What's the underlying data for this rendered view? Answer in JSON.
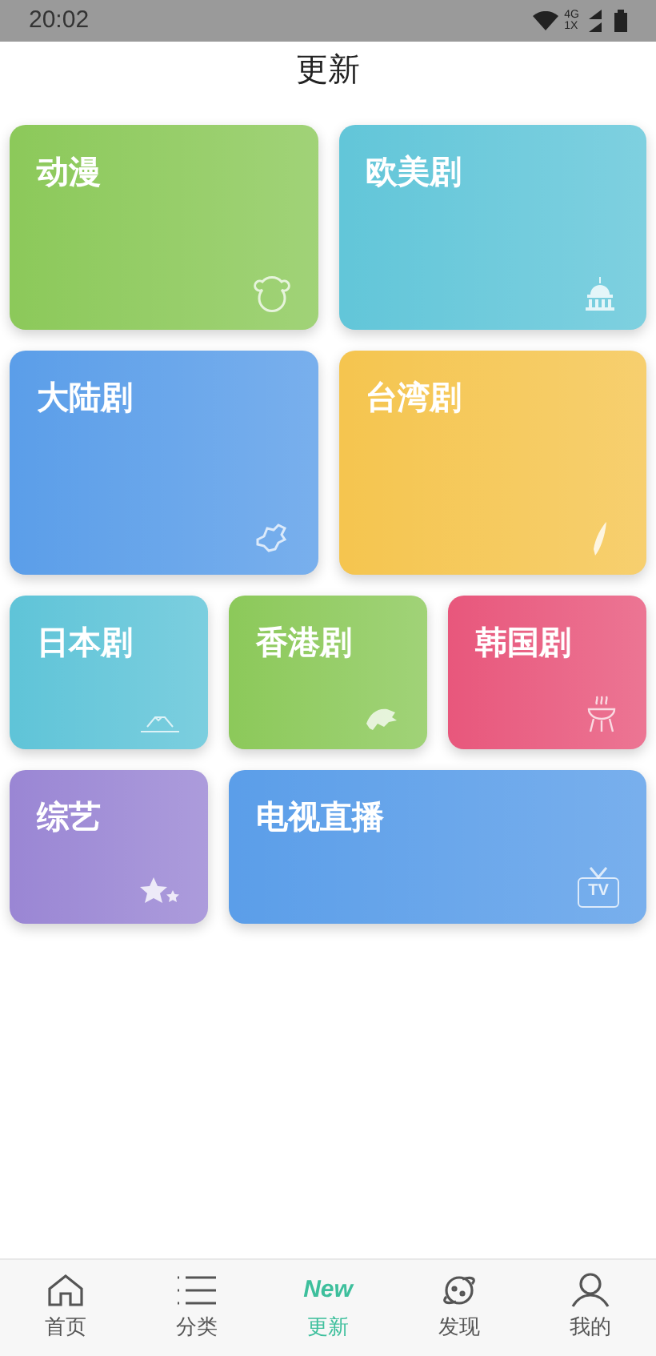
{
  "status_bar": {
    "time": "20:02",
    "network_top": "4G",
    "network_bottom": "1X"
  },
  "title": "更新",
  "card_rows": [
    {
      "cards": [
        {
          "label": "动漫",
          "color": "#8cc95a"
        },
        {
          "label": "欧美剧",
          "color": "#62c6d9"
        }
      ]
    },
    {
      "cards": [
        {
          "label": "大陆剧",
          "color": "#5b9ee9"
        },
        {
          "label": "台湾剧",
          "color": "#f5c54f"
        }
      ]
    },
    {
      "cards": [
        {
          "label": "日本剧",
          "color": "#5fc4d8"
        },
        {
          "label": "香港剧",
          "color": "#8cc95a"
        },
        {
          "label": "韩国剧",
          "color": "#e8577c"
        }
      ]
    },
    {
      "cards": [
        {
          "label": "综艺",
          "color": "#9a86d4"
        },
        {
          "label": "电视直播",
          "icon_text": "TV",
          "color": "#5b9ee9"
        }
      ]
    }
  ],
  "tabs": [
    {
      "label": "首页",
      "selected": false
    },
    {
      "label": "分类",
      "selected": false
    },
    {
      "label": "更新",
      "icon_text": "New",
      "selected": true
    },
    {
      "label": "发现",
      "selected": false
    },
    {
      "label": "我的",
      "selected": false
    }
  ]
}
